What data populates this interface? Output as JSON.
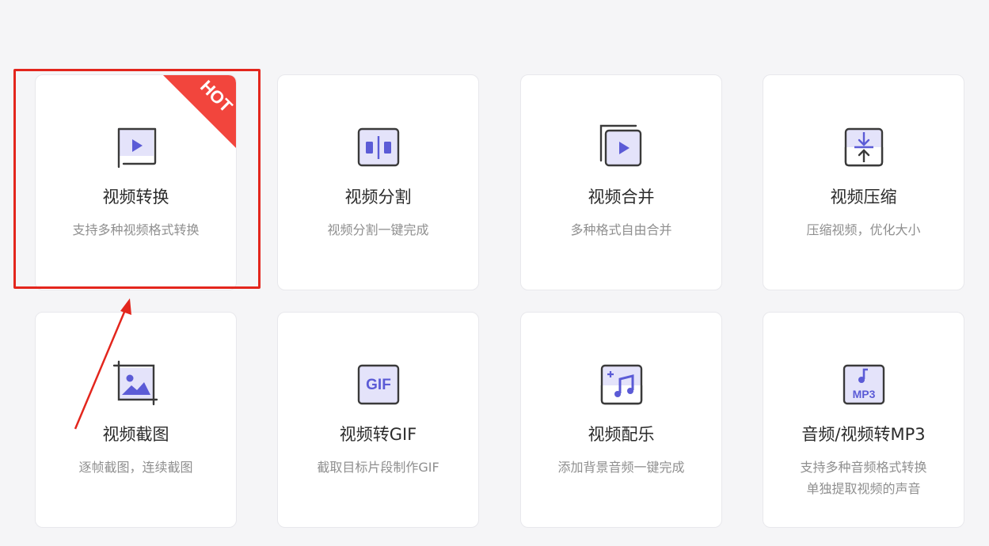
{
  "cards": [
    {
      "title": "视频转换",
      "desc": "支持多种视频格式转换",
      "icon": "video-convert-icon",
      "badge": "HOT"
    },
    {
      "title": "视频分割",
      "desc": "视频分割一键完成",
      "icon": "video-split-icon"
    },
    {
      "title": "视频合并",
      "desc": "多种格式自由合并",
      "icon": "video-merge-icon"
    },
    {
      "title": "视频压缩",
      "desc": "压缩视频，优化大小",
      "icon": "video-compress-icon"
    },
    {
      "title": "视频截图",
      "desc": "逐帧截图，连续截图",
      "icon": "video-screenshot-icon"
    },
    {
      "title": "视频转GIF",
      "desc": "截取目标片段制作GIF",
      "icon": "gif-icon",
      "icon_text": "GIF"
    },
    {
      "title": "视频配乐",
      "desc": "添加背景音频一键完成",
      "icon": "music-add-icon"
    },
    {
      "title": "音频/视频转MP3",
      "desc": "支持多种音频格式转换",
      "desc2": "单独提取视频的声音",
      "icon": "mp3-icon",
      "icon_text": "MP3"
    }
  ],
  "colors": {
    "accent": "#5b5bd6",
    "icon_fill": "#e4e3fa",
    "icon_stroke": "#3a3a3a",
    "hot_badge": "#f2453d",
    "annotation_red": "#e3261d"
  }
}
